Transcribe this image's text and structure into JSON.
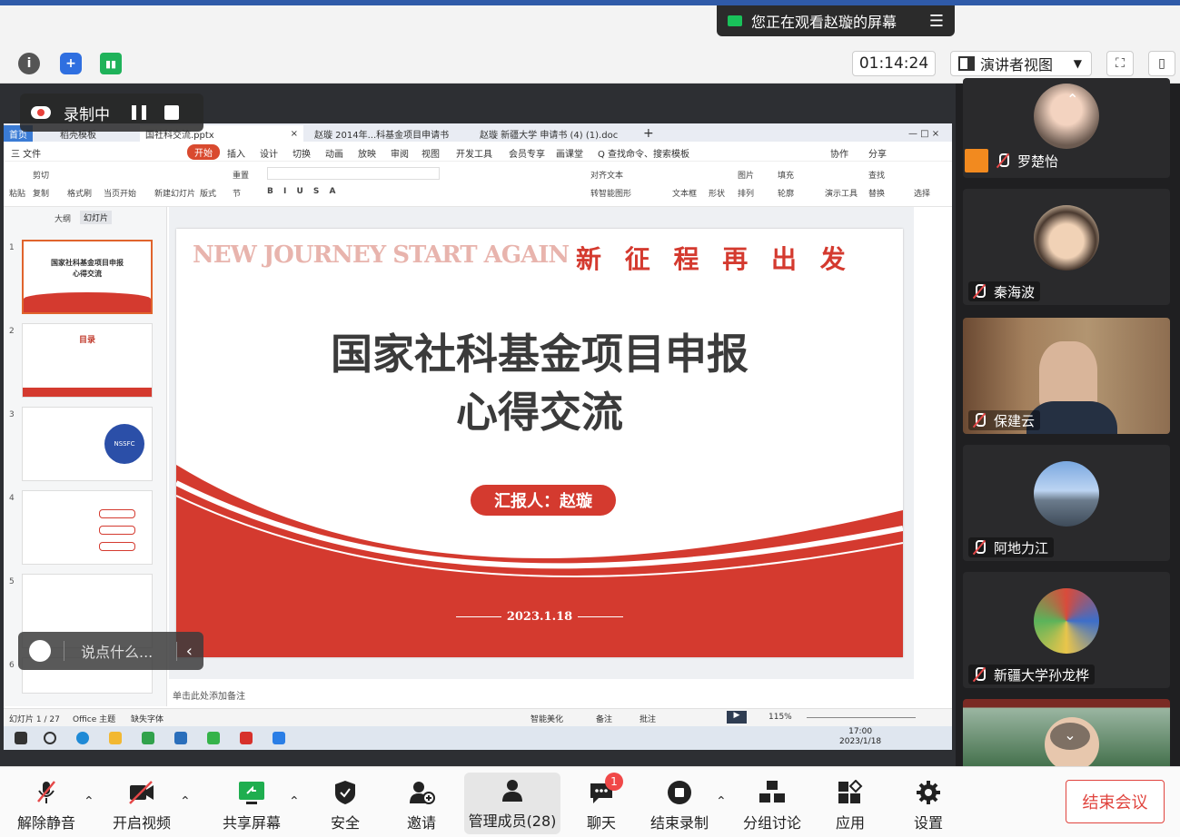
{
  "banner": {
    "watching_text": "您正在观看赵璇的屏幕",
    "menu_icon": "menu-icon"
  },
  "meeting_toolbar": {
    "clock": "01:14:24",
    "view_mode": "演讲者视图",
    "icons": [
      "info-icon",
      "shield-icon",
      "signal-icon"
    ]
  },
  "recording": {
    "label": "录制中"
  },
  "wps": {
    "tabs": [
      "首页",
      "稻壳模板",
      "国社科交流.pptx",
      "赵璇 2014年...科基金项目申请书",
      "赵璇 新疆大学 申请书 (4) (1).doc"
    ],
    "menu": [
      "三 文件",
      "开始",
      "插入",
      "设计",
      "切换",
      "动画",
      "放映",
      "审阅",
      "视图",
      "开发工具",
      "会员专享",
      "画课堂",
      "Q 查找命令、搜索模板",
      "协作",
      "分享"
    ],
    "ribbon": [
      "粘贴",
      "剪切",
      "复制",
      "格式刷",
      "当页开始",
      "新建幻灯片",
      "版式",
      "节",
      "重置",
      "文本框",
      "形状",
      "排列",
      "图片",
      "填充",
      "轮廓",
      "演示工具",
      "查找",
      "替换",
      "选择",
      "转智能图形",
      "对齐文本"
    ],
    "pane_tabs": [
      "大纲",
      "幻灯片"
    ],
    "slide_numbers": [
      "1",
      "2",
      "3",
      "4",
      "5",
      "6"
    ],
    "thumbs": {
      "t1_title": "国家社科基金项目申报",
      "t1_sub": "心得交流",
      "t2_title": "目录",
      "t3_badge": "NSSFC"
    },
    "slide": {
      "en_title": "NEW JOURNEY START AGAIN",
      "cn_banner": "新 征 程 再 出 发",
      "title_line1": "国家社科基金项目申报",
      "title_line2": "心得交流",
      "presenter": "汇报人：赵璇",
      "date": "2023.1.18"
    },
    "notes_placeholder": "单击此处添加备注",
    "status": {
      "slide_count": "幻灯片 1 / 27",
      "theme": "Office 主题",
      "font_warn": "缺失字体",
      "beautify": "智能美化",
      "notes": "备注",
      "comments": "批注",
      "zoom": "115%"
    },
    "taskbar": {
      "time": "17:00",
      "date": "2023/1/18"
    }
  },
  "chat_pill": {
    "placeholder": "说点什么..."
  },
  "participants": [
    {
      "name": "罗楚怡"
    },
    {
      "name": "秦海波"
    },
    {
      "name": "保建云"
    },
    {
      "name": "阿地力江"
    },
    {
      "name": "新疆大学孙龙桦"
    }
  ],
  "bottom_toolbar": {
    "unmute": "解除静音",
    "video": "开启视频",
    "share": "共享屏幕",
    "security": "安全",
    "invite": "邀请",
    "manage": "管理成员(28)",
    "chat": "聊天",
    "chat_badge": "1",
    "end_record": "结束录制",
    "breakout": "分组讨论",
    "apps": "应用",
    "settings": "设置",
    "end_meeting": "结束会议"
  },
  "colors": {
    "accent_red": "#d43a2f",
    "dark_bg": "#1f1f21",
    "title_gray": "#3b3b3b"
  }
}
